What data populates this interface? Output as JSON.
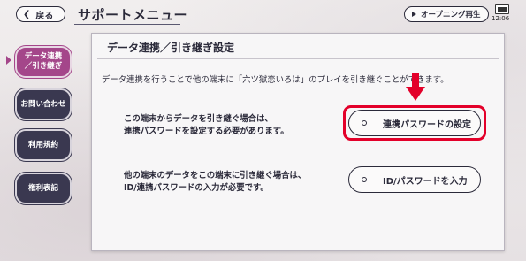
{
  "header": {
    "back_label": "戻る",
    "title": "サポートメニュー",
    "opening_label": "オープニング再生",
    "clock": "12:06"
  },
  "sidebar": {
    "items": [
      {
        "label": "データ連携\n／引き継ぎ",
        "active": true
      },
      {
        "label": "お問い合わせ",
        "active": false
      },
      {
        "label": "利用規約",
        "active": false
      },
      {
        "label": "権利表記",
        "active": false
      }
    ]
  },
  "panel": {
    "title": "データ連携／引き継ぎ設定",
    "intro": "データ連携を行うことで他の端末に「六ツ獄恋いろは」のプレイを引き継ぐことができます。",
    "sections": [
      {
        "desc_line1": "この端末からデータを引き継ぐ場合は、",
        "desc_line2": "連携パスワードを設定する必要があります。",
        "button_label": "連携パスワードの設定"
      },
      {
        "desc_line1": "他の端末のデータをこの端末に引き継ぐ場合は、",
        "desc_line2": "ID/連携パスワードの入力が必要です。",
        "button_label": "ID/パスワードを入力"
      }
    ]
  },
  "colors": {
    "accent": "#a4468a",
    "nav": "#3a3850",
    "highlight": "#e3002a"
  }
}
